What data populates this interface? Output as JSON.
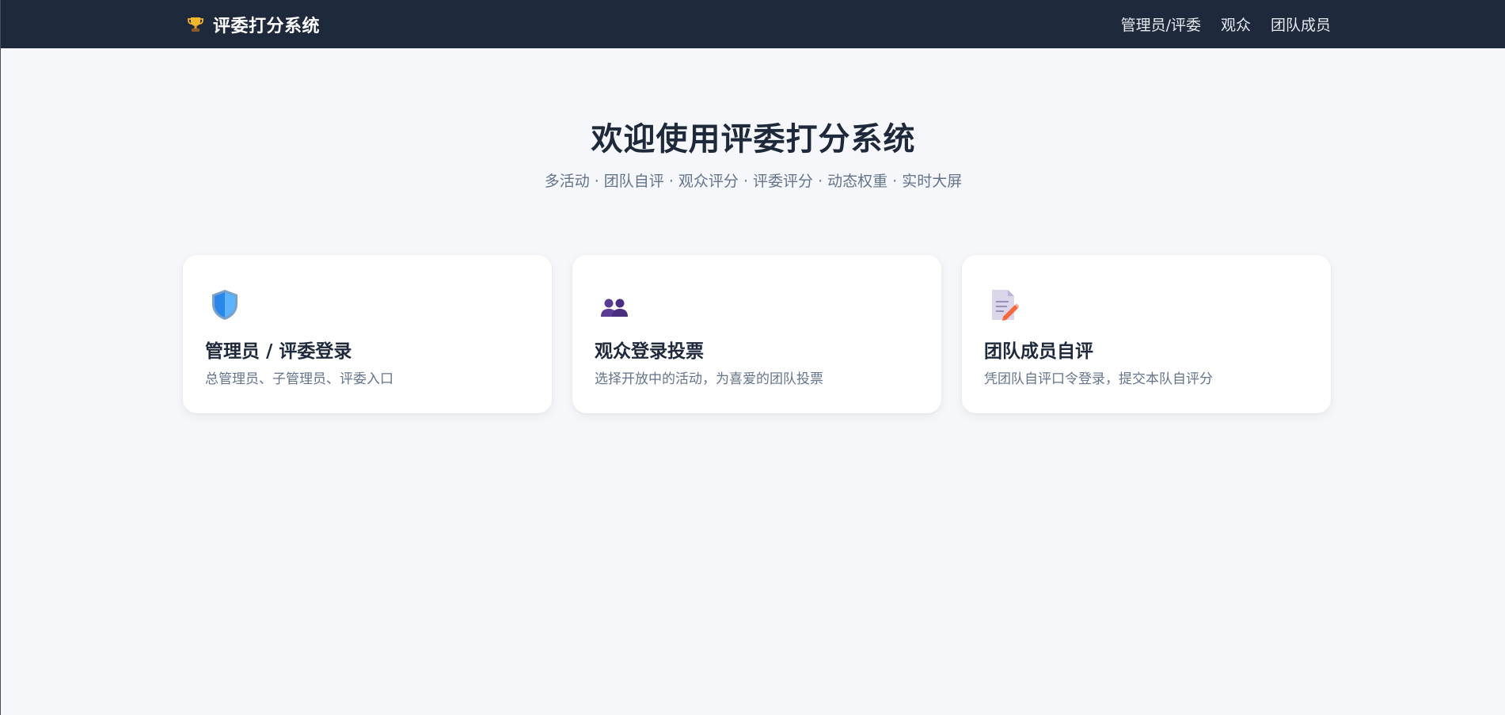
{
  "header": {
    "brand_icon": "trophy-icon",
    "title": "评委打分系统",
    "nav": [
      {
        "label": "管理员/评委"
      },
      {
        "label": "观众"
      },
      {
        "label": "团队成员"
      }
    ]
  },
  "hero": {
    "title": "欢迎使用评委打分系统",
    "subtitle": "多活动 · 团队自评 · 观众评分 · 评委评分 · 动态权重 · 实时大屏"
  },
  "cards": [
    {
      "icon": "shield-icon",
      "title": "管理员 / 评委登录",
      "desc": "总管理员、子管理员、评委入口"
    },
    {
      "icon": "users-icon",
      "title": "观众登录投票",
      "desc": "选择开放中的活动，为喜爱的团队投票"
    },
    {
      "icon": "memo-icon",
      "title": "团队成员自评",
      "desc": "凭团队自评口令登录，提交本队自评分"
    }
  ],
  "colors": {
    "navbar": "#1e293b",
    "background": "#f5f7fa",
    "title": "#1e293b",
    "muted": "#64748b",
    "card": "#ffffff"
  }
}
